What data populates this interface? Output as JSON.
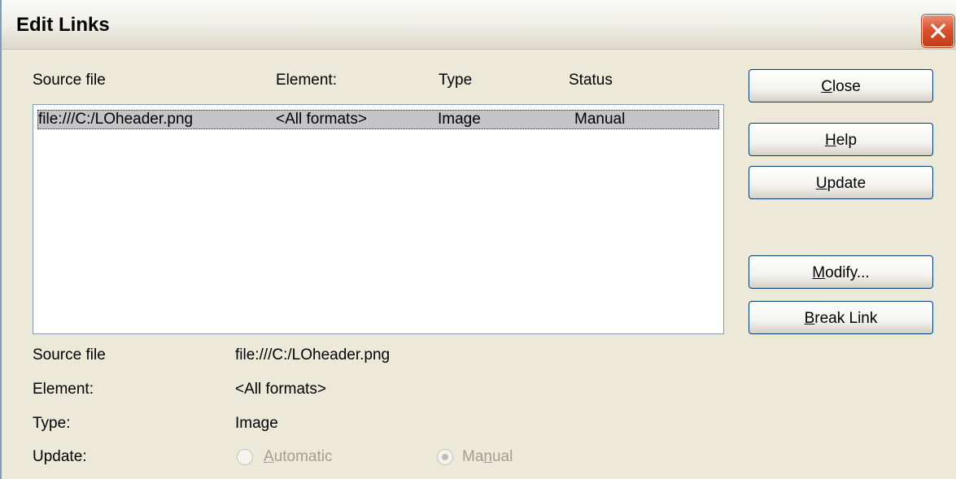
{
  "window": {
    "title": "Edit Links",
    "close_icon": "close-x-icon"
  },
  "list": {
    "headers": {
      "source": "Source file",
      "element": "Element:",
      "type": "Type",
      "status": "Status"
    },
    "rows": [
      {
        "source": "file:///C:/LOheader.png",
        "element": "<All formats>",
        "type": "Image",
        "status": "Manual",
        "selected": true
      }
    ]
  },
  "buttons": {
    "close": {
      "acc": "C",
      "rest": "lose"
    },
    "help": {
      "acc": "H",
      "rest": "elp"
    },
    "update": {
      "acc": "U",
      "rest": "pdate"
    },
    "modify": {
      "acc": "M",
      "rest": "odify..."
    },
    "break_link": {
      "acc": "B",
      "rest": "reak Link"
    }
  },
  "details": {
    "source_label": "Source file",
    "source_value": "file:///C:/LOheader.png",
    "element_label": "Element:",
    "element_value": "<All formats>",
    "type_label": "Type:",
    "type_value": "Image",
    "update_label": "Update:",
    "automatic": {
      "acc": "A",
      "rest": "utomatic",
      "checked": false,
      "enabled": false
    },
    "manual": {
      "pre": "Ma",
      "acc": "n",
      "rest": "ual",
      "checked": true,
      "enabled": false
    }
  }
}
